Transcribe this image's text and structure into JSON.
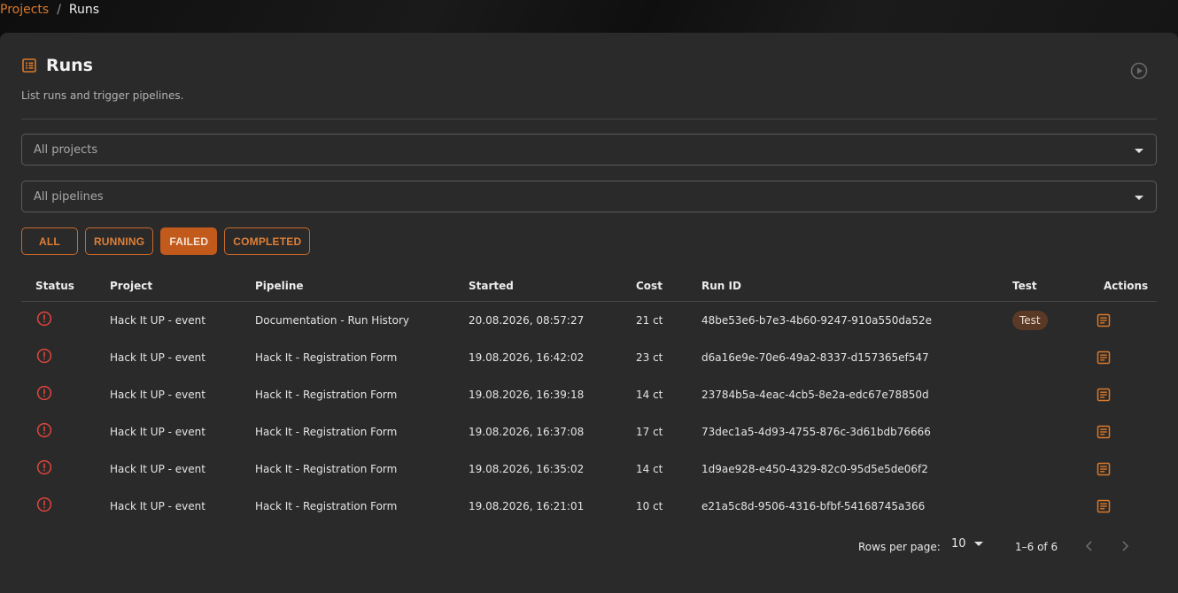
{
  "breadcrumb": {
    "parent": "Projects",
    "separator": "/",
    "current": "Runs"
  },
  "header": {
    "title": "Runs",
    "subtitle": "List runs and trigger pipelines."
  },
  "filters": {
    "project_select": "All projects",
    "pipeline_select": "All pipelines",
    "chips": [
      "ALL",
      "RUNNING",
      "FAILED",
      "COMPLETED"
    ],
    "active_chip": "FAILED"
  },
  "table": {
    "columns": [
      "Status",
      "Project",
      "Pipeline",
      "Started",
      "Cost",
      "Run ID",
      "Test",
      "Actions"
    ],
    "rows": [
      {
        "status": "failed",
        "project": "Hack It UP - event",
        "pipeline": "Documentation - Run History",
        "started": "20.08.2026, 08:57:27",
        "cost": "21 ct",
        "run_id": "48be53e6-b7e3-4b60-9247-910a550da52e",
        "test": "Test"
      },
      {
        "status": "failed",
        "project": "Hack It UP - event",
        "pipeline": "Hack It - Registration Form",
        "started": "19.08.2026, 16:42:02",
        "cost": "23 ct",
        "run_id": "d6a16e9e-70e6-49a2-8337-d157365ef547",
        "test": ""
      },
      {
        "status": "failed",
        "project": "Hack It UP - event",
        "pipeline": "Hack It - Registration Form",
        "started": "19.08.2026, 16:39:18",
        "cost": "14 ct",
        "run_id": "23784b5a-4eac-4cb5-8e2a-edc67e78850d",
        "test": ""
      },
      {
        "status": "failed",
        "project": "Hack It UP - event",
        "pipeline": "Hack It - Registration Form",
        "started": "19.08.2026, 16:37:08",
        "cost": "17 ct",
        "run_id": "73dec1a5-4d93-4755-876c-3d61bdb76666",
        "test": ""
      },
      {
        "status": "failed",
        "project": "Hack It UP - event",
        "pipeline": "Hack It - Registration Form",
        "started": "19.08.2026, 16:35:02",
        "cost": "14 ct",
        "run_id": "1d9ae928-e450-4329-82c0-95d5e5de06f2",
        "test": ""
      },
      {
        "status": "failed",
        "project": "Hack It UP - event",
        "pipeline": "Hack It - Registration Form",
        "started": "19.08.2026, 16:21:01",
        "cost": "10 ct",
        "run_id": "e21a5c8d-9506-4316-bfbf-54168745a366",
        "test": ""
      }
    ]
  },
  "pagination": {
    "rows_per_page_label": "Rows per page:",
    "rows_per_page": "10",
    "range": "1–6 of 6"
  },
  "icons": {
    "title": "list-icon",
    "play": "play-circle-icon",
    "status_failed": "error-circle-icon",
    "action": "document-icon",
    "prev": "chevron-left-icon",
    "next": "chevron-right-icon",
    "dropdown": "caret-down-icon"
  },
  "colors": {
    "accent": "#d9792b",
    "active_chip_bg": "#c25a1c",
    "error": "#e0463c",
    "panel": "#2a2a2a",
    "badge_bg": "#5a3a26"
  }
}
